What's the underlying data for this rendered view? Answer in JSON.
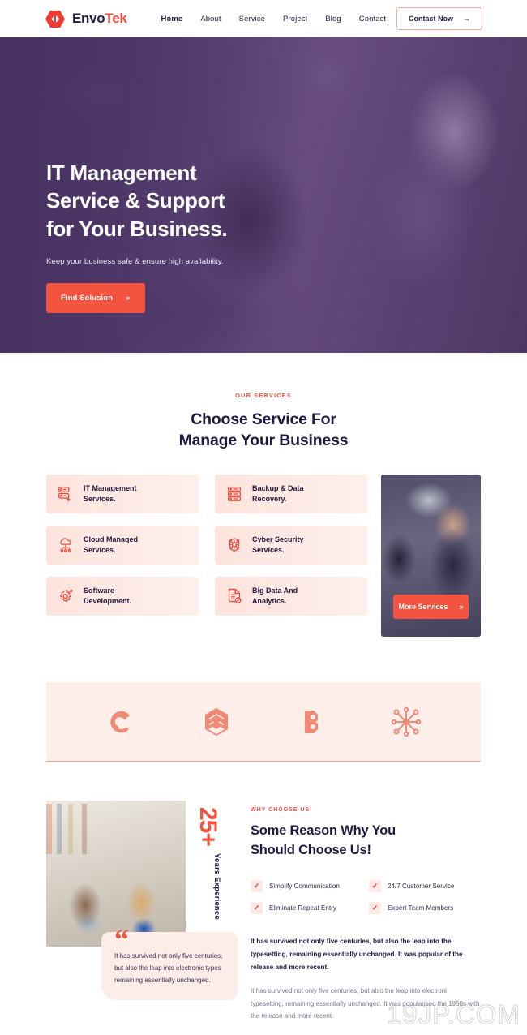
{
  "header": {
    "logo": {
      "mark": "hexagon-logo-icon",
      "text_primary": "Envo",
      "text_accent": "Tek"
    },
    "nav": [
      {
        "label": "Home",
        "active": true
      },
      {
        "label": "About",
        "active": false
      },
      {
        "label": "Service",
        "active": false
      },
      {
        "label": "Project",
        "active": false
      },
      {
        "label": "Blog",
        "active": false
      },
      {
        "label": "Contact",
        "active": false
      }
    ],
    "cta": {
      "label": "Contact Now",
      "arrow": "→"
    }
  },
  "hero": {
    "title_line1": "IT Management",
    "title_line2": "Service & Support",
    "title_line3": "for Your Business.",
    "subtitle": "Keep your business safe & ensure high availability.",
    "button": {
      "label": "Find Solusion",
      "arrow": "»"
    }
  },
  "services": {
    "eyebrow": "OUR SERVICES",
    "title_line1": "Choose Service For",
    "title_line2": "Manage Your Business",
    "cards": [
      {
        "line1": "IT Management",
        "line2": "Services.",
        "icon": "server-click-icon"
      },
      {
        "line1": "Backup & Data",
        "line2": "Recovery.",
        "icon": "server-stack-icon"
      },
      {
        "line1": "Cloud Managed",
        "line2": "Services.",
        "icon": "cloud-network-icon"
      },
      {
        "line1": "Cyber Security",
        "line2": "Services.",
        "icon": "shield-circuit-icon"
      },
      {
        "line1": "Software",
        "line2": "Development.",
        "icon": "gear-code-icon"
      },
      {
        "line1": "Big Data And",
        "line2": "Analytics.",
        "icon": "document-check-icon"
      }
    ],
    "photo_button": {
      "label": "More Services",
      "arrow": "»"
    }
  },
  "partners": [
    {
      "name": "swirl-c-logo-icon"
    },
    {
      "name": "layered-hex-logo-icon"
    },
    {
      "name": "letter-b-logo-icon"
    },
    {
      "name": "node-network-logo-icon"
    }
  ],
  "why": {
    "experience_number": "25+",
    "experience_label": "Years Experience",
    "quote_mark": "“",
    "quote_text": "It has survived not only five centuries, but also the leap into electronic types remaining essentially unchanged.",
    "eyebrow": "WHY CHOOSE US!",
    "title_line1": "Some Reason Why You",
    "title_line2": "Should Choose Us!",
    "checks": [
      {
        "label": "Simplify Communication",
        "mark": "✓"
      },
      {
        "label": "24/7 Customer Service",
        "mark": "✓"
      },
      {
        "label": "Eliminate Repeat Entry",
        "mark": "✓"
      },
      {
        "label": "Expert Team Members",
        "mark": "✓"
      }
    ],
    "paragraph_bold": "It has survived not only five centuries, but also the leap into the typesetting, remaining essentially unchanged. It was popular of the release and more recent.",
    "paragraph_light": "It has survived not only five centuries, but also the leap into electroni typesetting, remaining essentially unchanged. It was popularised the 1960s with the release and more recent."
  },
  "watermark": "19JP.COM",
  "colors": {
    "accent": "#f4543f",
    "accent_dark": "#ef4a3c",
    "navy": "#211740",
    "card_pink": "#fde4de",
    "strip_pink": "#fdeeea",
    "partner_salmon": "#ef8a76",
    "hero_purple": "#5a4070"
  }
}
